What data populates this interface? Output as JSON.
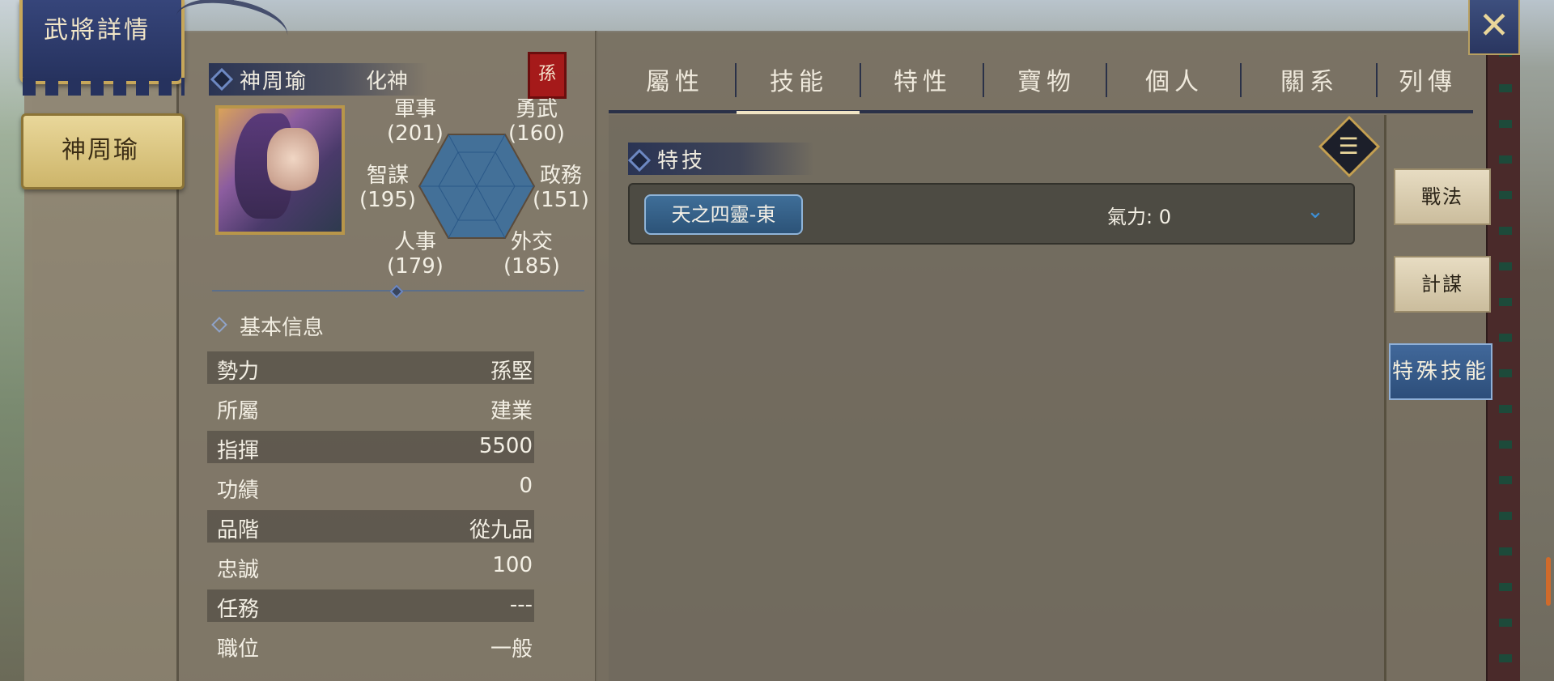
{
  "window": {
    "title": "武將詳情",
    "close_icon": "close-x-icon"
  },
  "character_tab": {
    "label": "神周瑜"
  },
  "hero": {
    "name": "神周瑜",
    "rank": "化神",
    "faction_badge": "孫",
    "portrait": "hero-portrait"
  },
  "stats": {
    "military": {
      "label": "軍事",
      "value": "(201)"
    },
    "valor": {
      "label": "勇武",
      "value": "(160)"
    },
    "strategy": {
      "label": "智謀",
      "value": "(195)"
    },
    "politics": {
      "label": "政務",
      "value": "(151)"
    },
    "personnel": {
      "label": "人事",
      "value": "(179)"
    },
    "diplomacy": {
      "label": "外交",
      "value": "(185)"
    }
  },
  "basic_info": {
    "title": "基本信息",
    "rows": [
      {
        "label": "勢力",
        "value": "孫堅"
      },
      {
        "label": "所屬",
        "value": "建業"
      },
      {
        "label": "指揮",
        "value": "5500"
      },
      {
        "label": "功績",
        "value": "0"
      },
      {
        "label": "品階",
        "value": "從九品"
      },
      {
        "label": "忠誠",
        "value": "100"
      },
      {
        "label": "任務",
        "value": "---"
      },
      {
        "label": "職位",
        "value": "一般"
      }
    ]
  },
  "tabs": [
    {
      "label": "屬性",
      "active": false
    },
    {
      "label": "技能",
      "active": true
    },
    {
      "label": "特性",
      "active": false
    },
    {
      "label": "寶物",
      "active": false
    },
    {
      "label": "個人",
      "active": false
    },
    {
      "label": "關系",
      "active": false
    },
    {
      "label": "列傳",
      "active": false
    }
  ],
  "skills": {
    "section_title": "特技",
    "list_icon": "list-menu-icon",
    "items": [
      {
        "name": "天之四靈-東",
        "energy": "氣力: 0",
        "expand_icon": "chevron-down-icon"
      }
    ]
  },
  "side_tabs": [
    {
      "label": "戰法",
      "active": false
    },
    {
      "label": "計謀",
      "active": false
    },
    {
      "label": "特殊技能",
      "active": true
    }
  ],
  "colors": {
    "accent_blue": "#2c5378",
    "gold": "#c4a052",
    "panel": "#7d7668",
    "text": "#f3efe4"
  }
}
